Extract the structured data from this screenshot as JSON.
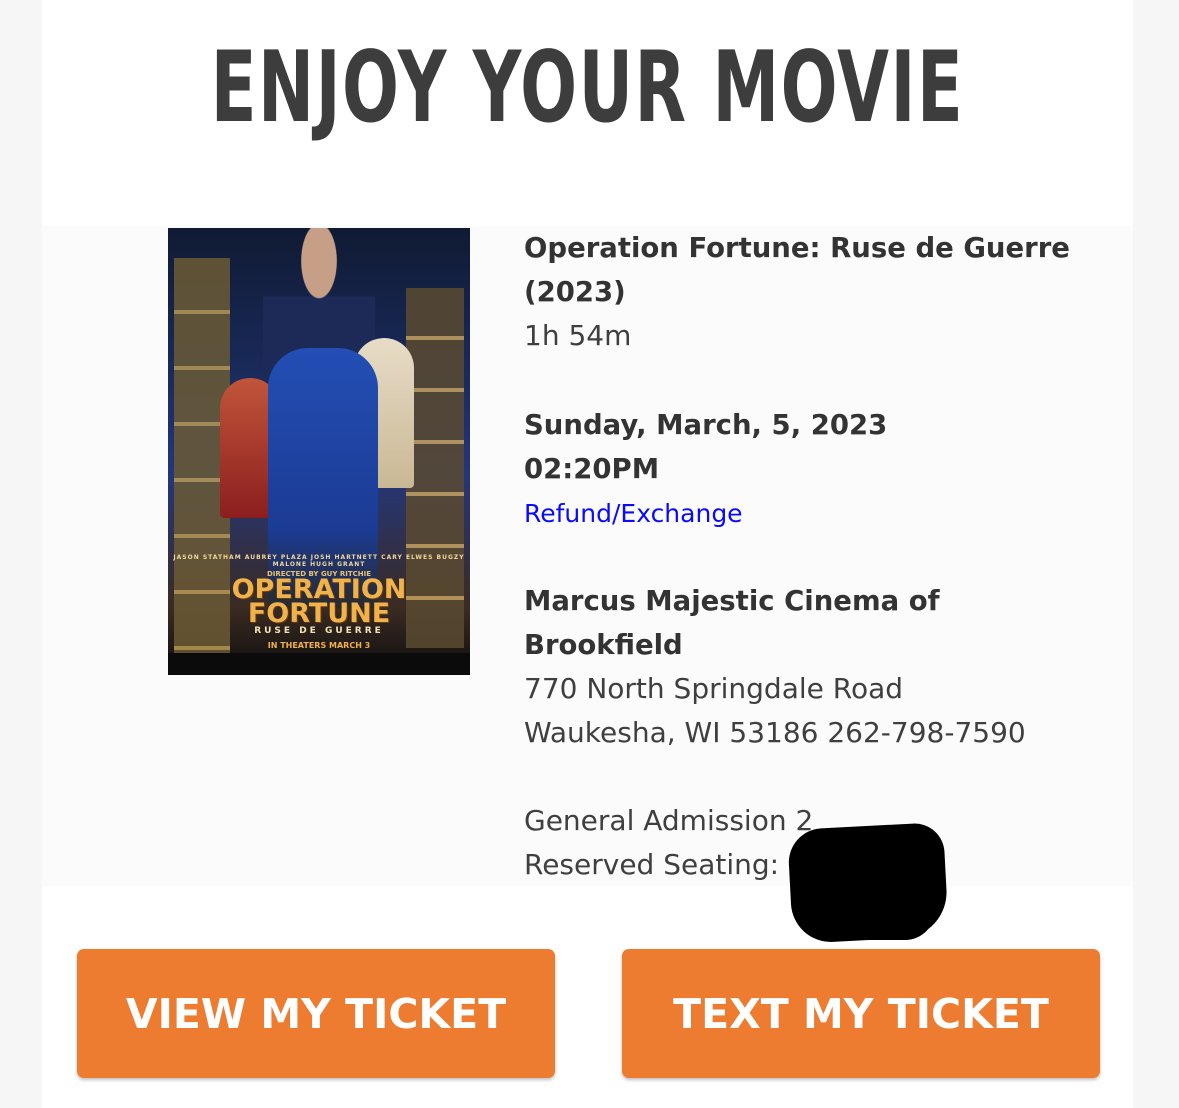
{
  "header": {
    "title": "ENJOY YOUR MOVIE"
  },
  "poster": {
    "credits": "JASON STATHAM   AUBREY PLAZA   JOSH HARTNETT   CARY ELWES   BUGZY MALONE   HUGH GRANT",
    "director": "DIRECTED BY GUY RITCHIE",
    "title_line1": "OPERATION",
    "title_line2": "FORTUNE",
    "subtitle": "RUSE DE GUERRE",
    "release": "IN THEATERS MARCH 3"
  },
  "movie": {
    "title_line1": "Operation Fortune: Ruse de Guerre",
    "title_line2": "(2023)",
    "runtime": "1h 54m"
  },
  "showtime": {
    "date": "Sunday, March, 5, 2023",
    "time": "02:20PM",
    "refund_link": "Refund/Exchange"
  },
  "theater": {
    "name_line1": "Marcus Majestic Cinema of",
    "name_line2": "Brookfield",
    "address_line1": "770 North Springdale Road",
    "address_line2": "Waukesha, WI 53186 262-798-7590"
  },
  "tickets": {
    "admission": "General Admission 2",
    "seating": "Reserved Seating: G"
  },
  "buttons": {
    "view": "VIEW MY TICKET",
    "text": "TEXT MY TICKET"
  },
  "colors": {
    "accent": "#ee7c30",
    "link": "#0a0aff",
    "text": "#333333"
  }
}
